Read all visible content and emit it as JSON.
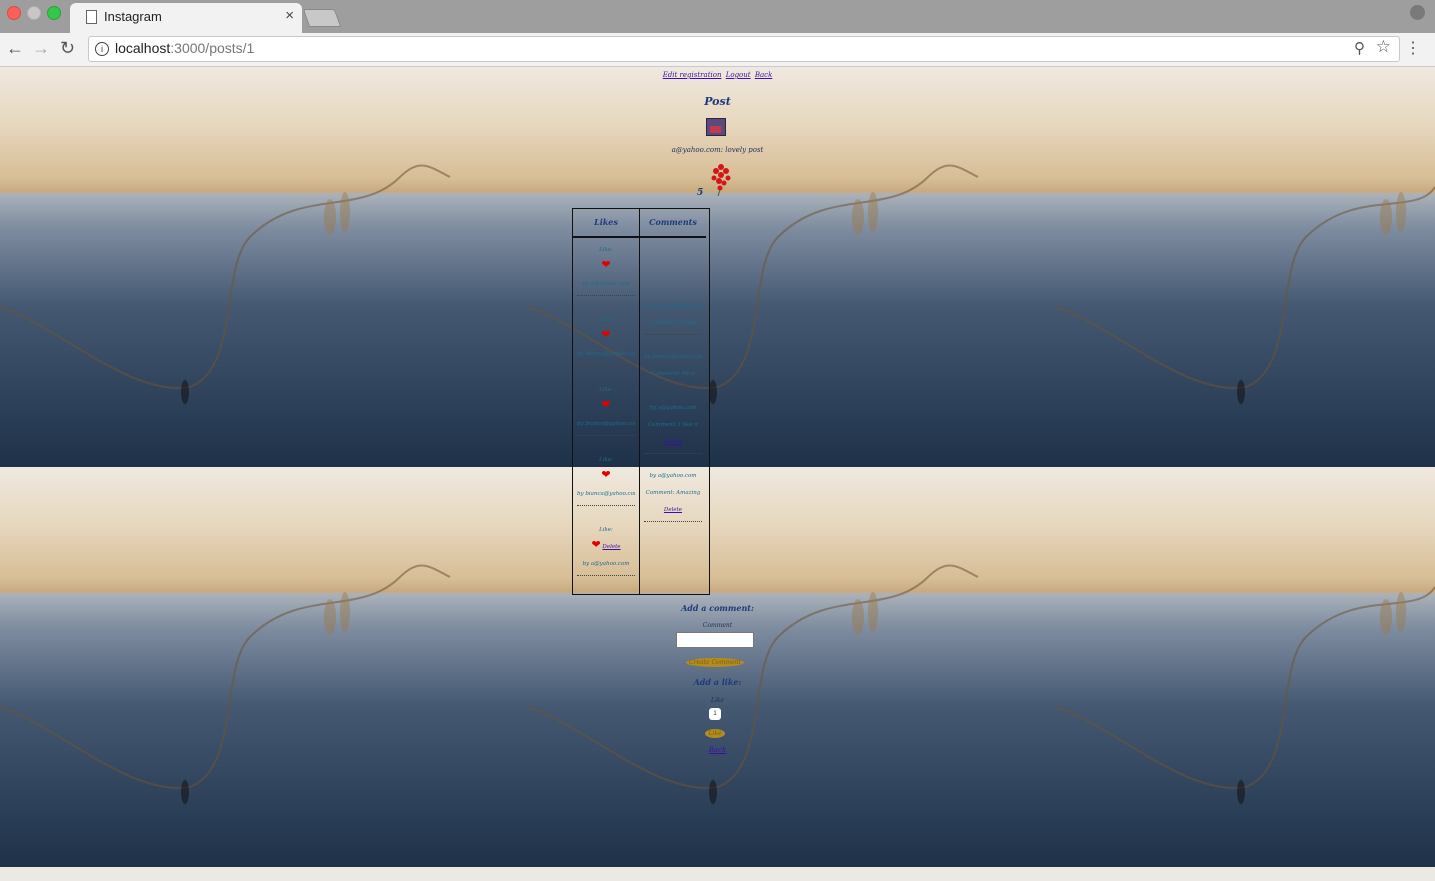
{
  "browser": {
    "tab_title": "Instagram",
    "tab_close": "×",
    "url_host": "localhost",
    "url_rest": ":3000/posts/1",
    "info_glyph": "i"
  },
  "page": {
    "top_links": [
      "Edit registration",
      "Logout",
      "Back"
    ],
    "heading": "Post",
    "caption": "a@yahoo.com: lovely post",
    "like_count": "5",
    "table_headers": [
      "Likes",
      "Comments"
    ],
    "likes": [
      {
        "label": "Like:",
        "user": "by d@yahoo.com",
        "delete": ""
      },
      {
        "label": "Like:",
        "user": "by bianca@yahoo.com",
        "delete": ""
      },
      {
        "label": "Like:",
        "user": "by bianca@yahoo.com",
        "delete": ""
      },
      {
        "label": "Like:",
        "user": "by bianca@yahoo.com",
        "delete": ""
      },
      {
        "label": "Like:",
        "user": "by a@yahoo.com",
        "delete": "Delete"
      }
    ],
    "comments": [
      {
        "user": "by bianca@yahoo.com",
        "text": "Comment: Great",
        "delete": ""
      },
      {
        "user": "by bianca@yahoo.com",
        "text": "Comment: Nice",
        "delete": ""
      },
      {
        "user": "by a@yahoo.com",
        "text": "Comment: I like it",
        "delete": "Delete"
      },
      {
        "user": "by a@yahoo.com",
        "text": "Comment: Amazing",
        "delete": "Delete"
      }
    ],
    "add_comment_heading": "Add a comment:",
    "comment_label": "Comment",
    "create_comment_button": "Create Comment",
    "add_like_heading": "Add a like:",
    "like_label": "Like",
    "like_value": "1",
    "like_button": "Like",
    "back_link": "Back"
  }
}
